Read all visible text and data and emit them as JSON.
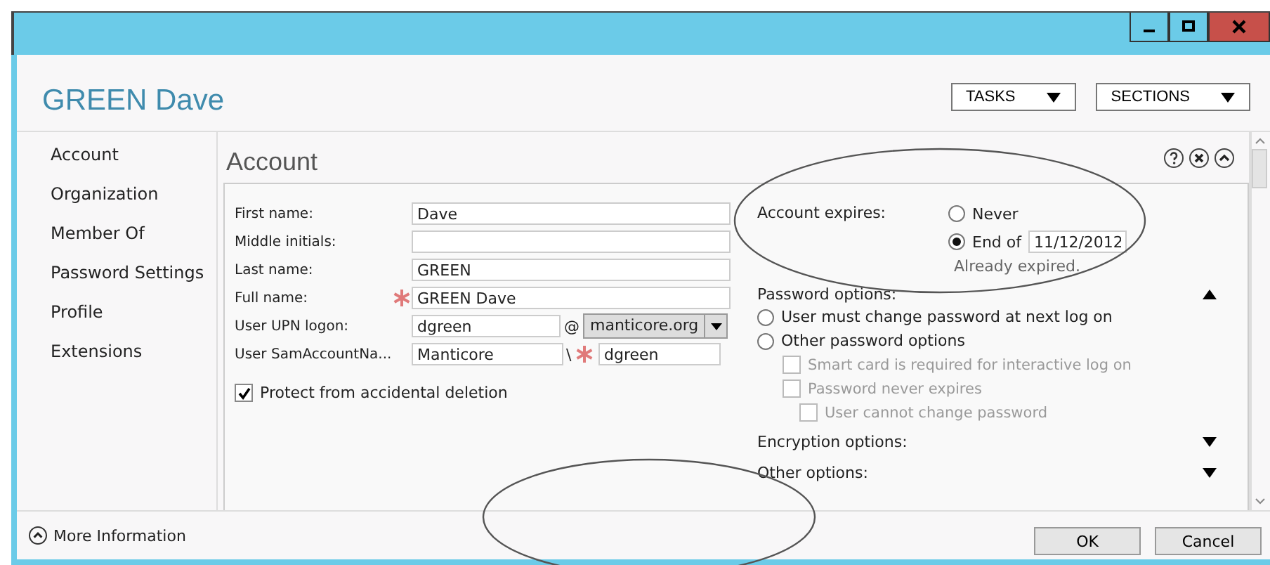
{
  "header": {
    "title": "GREEN Dave",
    "menus": [
      "TASKS",
      "SECTIONS"
    ]
  },
  "sidebar": {
    "items": [
      {
        "label": "Account"
      },
      {
        "label": "Organization"
      },
      {
        "label": "Member Of"
      },
      {
        "label": "Password Settings"
      },
      {
        "label": "Profile"
      },
      {
        "label": "Extensions"
      }
    ]
  },
  "section": {
    "title": "Account",
    "fields": [
      {
        "kind": "text",
        "label": "First name:",
        "value": "Dave",
        "required": false
      },
      {
        "kind": "text",
        "label": "Middle initials:",
        "required": false
      },
      {
        "kind": "text",
        "label": "Last name:",
        "value": "GREEN",
        "required": false
      },
      {
        "kind": "text",
        "label": "Full name:",
        "value": "GREEN Dave",
        "required": true
      },
      {
        "kind": "upn",
        "label": "User UPN logon:",
        "value": "dgreen",
        "separator": "@",
        "domain": "manticore.org"
      },
      {
        "kind": "sam",
        "label": "User SamAccountNa...",
        "domain": "Manticore",
        "separator": "\\",
        "value": "dgreen",
        "required": true
      }
    ],
    "protect": {
      "label": "Protect from accidental deletion",
      "checked": true
    },
    "expires": {
      "label": "Account expires:",
      "options": [
        {
          "label": "Never",
          "selected": false
        },
        {
          "label": "End of",
          "selected": true,
          "date": "11/12/2012"
        }
      ],
      "note": "Already expired."
    },
    "password_options": {
      "title": "Password options:",
      "expanded": true,
      "radios": [
        {
          "label": "User must change password at next log on",
          "selected": false
        },
        {
          "label": "Other password options",
          "selected": false
        }
      ],
      "checkboxes": [
        {
          "label": "Smart card is required for interactive log on",
          "checked": false,
          "disabled": true
        },
        {
          "label": "Password never expires",
          "checked": false,
          "disabled": true,
          "children": [
            {
              "label": "User cannot change password",
              "checked": false,
              "disabled": true
            }
          ]
        }
      ]
    },
    "groups": [
      {
        "title": "Encryption options:",
        "expanded": false
      },
      {
        "title": "Other options:",
        "expanded": false
      }
    ]
  },
  "footer": {
    "more_info": "More Information",
    "buttons": [
      "OK",
      "Cancel"
    ]
  }
}
